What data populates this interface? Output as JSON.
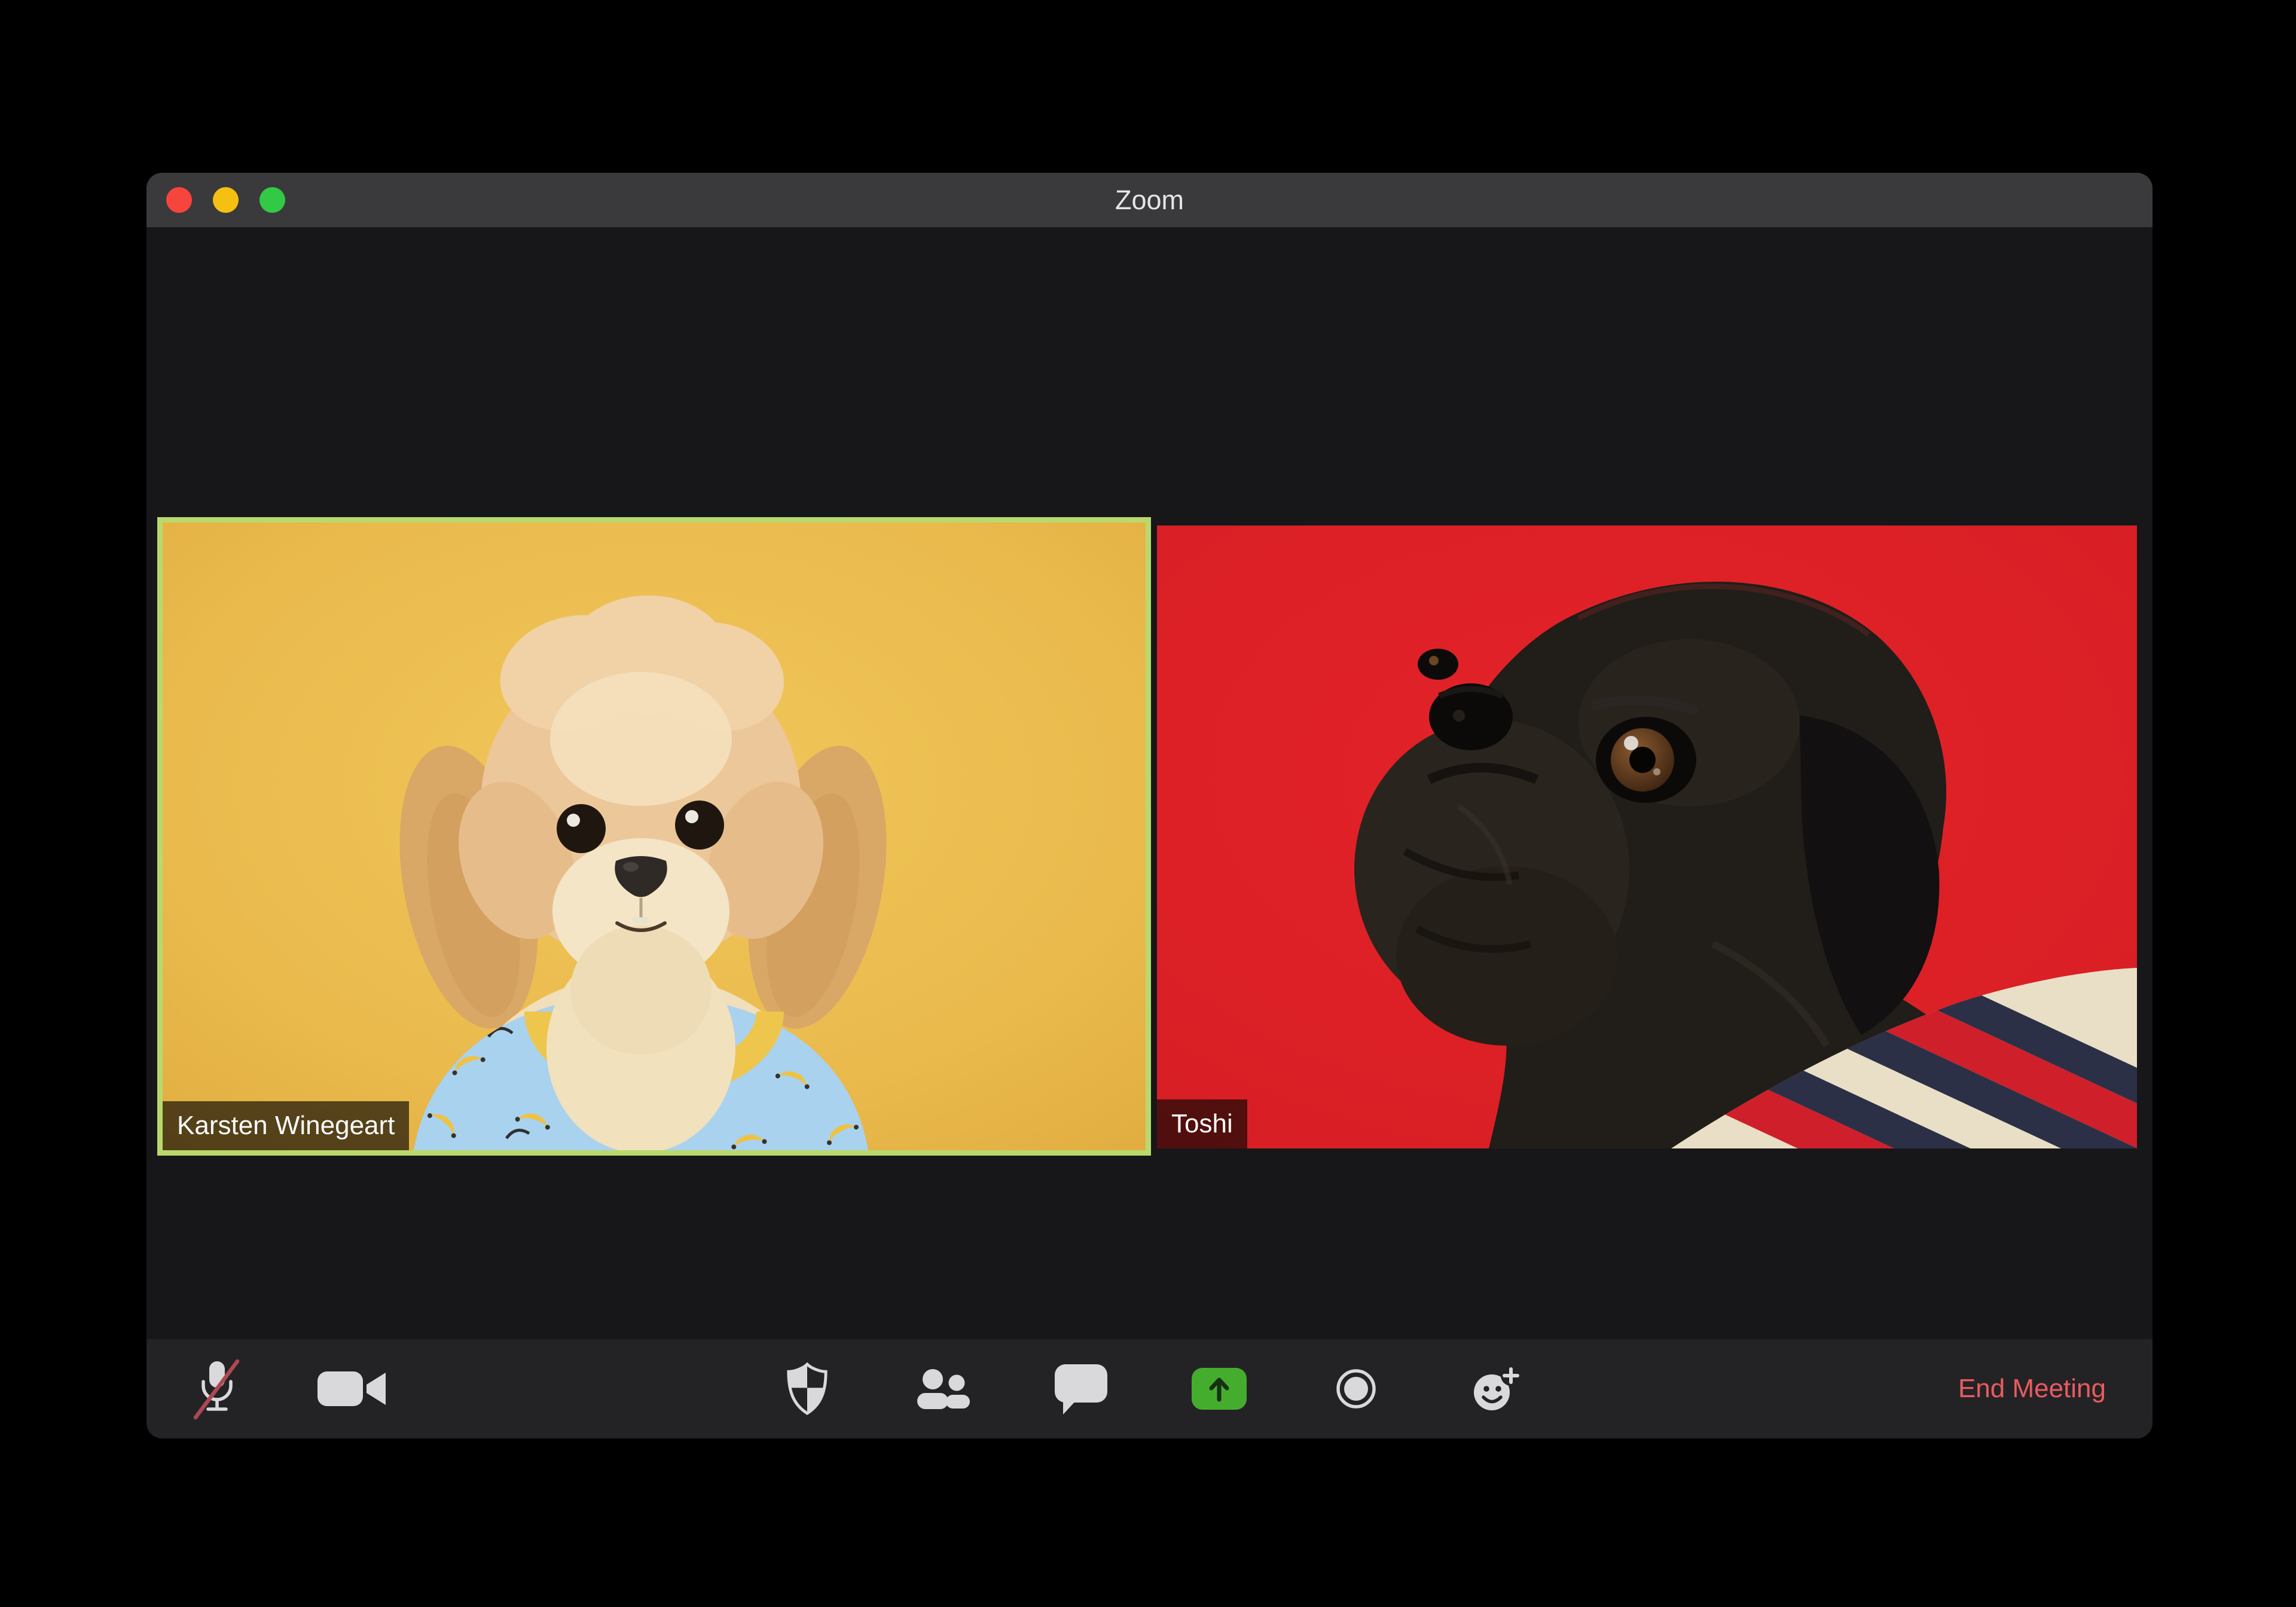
{
  "window": {
    "title": "Zoom",
    "controls": [
      "close-button",
      "minimize-button",
      "zoom-button"
    ]
  },
  "participants": [
    {
      "name": "Karsten Winegeart",
      "background_color": "#eaba4e",
      "active_speaker": true,
      "subject": "tan fluffy dog in blue banana shirt"
    },
    {
      "name": "Toshi",
      "background_color": "#dd2026",
      "active_speaker": false,
      "subject": "black pug in striped sweater"
    }
  ],
  "toolbar": {
    "icons": [
      "microphone-muted-icon",
      "camera-icon",
      "security-shield-icon",
      "participants-icon",
      "chat-icon",
      "share-screen-icon",
      "record-icon",
      "reactions-icon"
    ],
    "end_meeting_label": "End Meeting"
  },
  "colors": {
    "titlebar": "#3a3a3c",
    "window_background": "#17171a",
    "toolbar_background": "#232326",
    "active_speaker_border": "#b8d96c",
    "share_button_green": "#45ad2e",
    "end_meeting_red": "#ea5b5e",
    "mute_slash_red": "#ad4853",
    "icon_gray": "#d9d9db",
    "traffic_red": "#f6453c",
    "traffic_yellow": "#f5c011",
    "traffic_green": "#32c946"
  }
}
